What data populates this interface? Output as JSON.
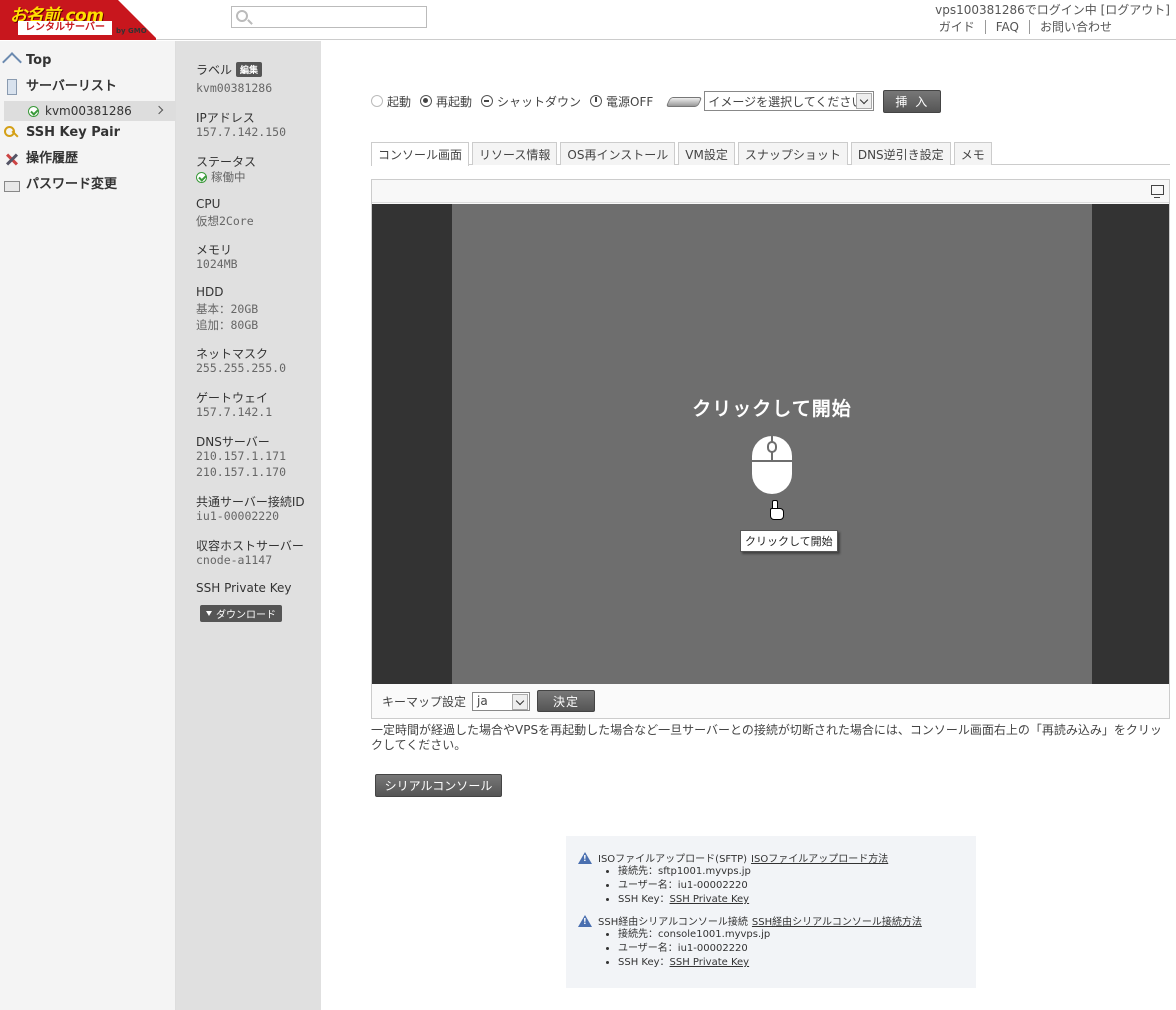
{
  "header": {
    "logo_main": "お名前.com",
    "logo_sub": "レンタルサーバー",
    "logo_gmo": "by GMO",
    "search_placeholder": "",
    "login_info": "vps100381286でログイン中 [ログアウト]",
    "links": [
      "ガイド",
      "FAQ",
      "お問い合わせ"
    ]
  },
  "nav": {
    "top": "Top",
    "server_list": "サーバーリスト",
    "server_item": "kvm00381286",
    "ssh_key_pair": "SSH Key Pair",
    "history": "操作履歴",
    "password": "パスワード変更"
  },
  "info": {
    "label_title": "ラベル",
    "edit": "編集",
    "label_val": "kvm00381286",
    "ip_title": "IPアドレス",
    "ip_val": "157.7.142.150",
    "status_title": "ステータス",
    "status_val": "稼働中",
    "cpu_title": "CPU",
    "cpu_val": "仮想2Core",
    "mem_title": "メモリ",
    "mem_val": "1024MB",
    "hdd_title": "HDD",
    "hdd_base": "基本：20GB",
    "hdd_add": "追加：80GB",
    "netmask_title": "ネットマスク",
    "netmask_val": "255.255.255.0",
    "gateway_title": "ゲートウェイ",
    "gateway_val": "157.7.142.1",
    "dns_title": "DNSサーバー",
    "dns_val1": "210.157.1.171",
    "dns_val2": "210.157.1.170",
    "shared_title": "共通サーバー接続ID",
    "shared_val": "iu1-00002220",
    "host_title": "収容ホストサーバー",
    "host_val": "cnode-a1147",
    "ssh_title": "SSH Private Key",
    "download": "ダウンロード"
  },
  "power": {
    "start": "起動",
    "restart": "再起動",
    "shutdown": "シャットダウン",
    "off": "電源OFF",
    "image_select": "イメージを選択してください",
    "insert": "挿 入"
  },
  "tabs": [
    "コンソール画面",
    "リソース情報",
    "OS再インストール",
    "VM設定",
    "スナップショット",
    "DNS逆引き設定",
    "メモ"
  ],
  "console": {
    "click_start": "クリックして開始",
    "tooltip": "クリックして開始",
    "keymap_label": "キーマップ設定",
    "keymap_value": "ja",
    "decide": "決定"
  },
  "notice": "一定時間が経過した場合やVPSを再起動した場合など一旦サーバーとの接続が切断された場合には、コンソール画面右上の「再読み込み」をクリックしてください。",
  "serial_console": "シリアルコンソール",
  "info_box": {
    "iso_title": "ISOファイルアップロード(SFTP)",
    "iso_link": "ISOファイルアップロード方法",
    "iso_host": "接続先：sftp1001.myvps.jp",
    "iso_user": "ユーザー名：iu1-00002220",
    "iso_key_label": "SSH Key：",
    "iso_key_link": "SSH Private Key",
    "ssh_title": "SSH経由シリアルコンソール接続",
    "ssh_link": "SSH経由シリアルコンソール接続方法",
    "ssh_host": "接続先：console1001.myvps.jp",
    "ssh_user": "ユーザー名：iu1-00002220",
    "ssh_key_label": "SSH Key：",
    "ssh_key_link": "SSH Private Key"
  }
}
